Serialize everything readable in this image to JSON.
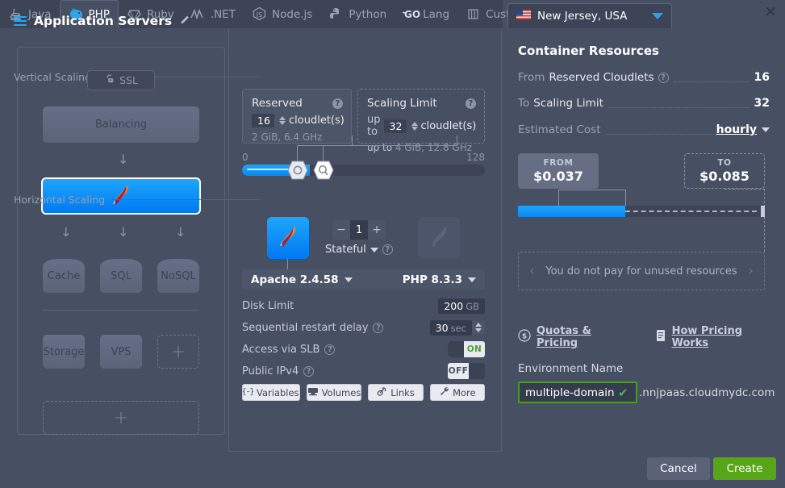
{
  "tabs": [
    {
      "label": "Java",
      "icon": "java-icon",
      "active": false
    },
    {
      "label": "PHP",
      "icon": "php-elephant-icon",
      "active": true
    },
    {
      "label": "Ruby",
      "icon": "ruby-gem-icon",
      "active": false
    },
    {
      "label": ".NET",
      "icon": "dotnet-icon",
      "active": false
    },
    {
      "label": "Node.js",
      "icon": "nodejs-icon",
      "active": false
    },
    {
      "label": "Python",
      "icon": "python-icon",
      "active": false
    },
    {
      "label": "Lang",
      "icon": "go-lang-icon",
      "active": false
    },
    {
      "label": "Custom",
      "icon": "custom-stack-icon",
      "active": false
    }
  ],
  "topology": {
    "ssl_label": "SSL",
    "balancing_label": "Balancing",
    "app_node_icon": "apache-feather-icon",
    "tier_nodes": [
      "Cache",
      "SQL",
      "NoSQL"
    ],
    "extra_nodes": [
      "Storage",
      "VPS"
    ],
    "add_label": "+"
  },
  "middle": {
    "title": "Application Servers",
    "toggle_label": "ON",
    "vertical_section": "Vertical Scaling per Node",
    "reserved": {
      "title": "Reserved",
      "value": "16",
      "unit": "cloudlet(s)",
      "detail": "2 GiB, 6.4 GHz"
    },
    "scaling_limit": {
      "title": "Scaling Limit",
      "prefix": "up to",
      "value": "32",
      "unit": "cloudlet(s)",
      "detail_prefix": "up to",
      "detail": "4 GiB, 12.8 GHz"
    },
    "slider": {
      "min": "0",
      "max": "128"
    },
    "horizontal_section": "Horizontal Scaling",
    "node_count": "1",
    "minus": "−",
    "plus": "+",
    "stateful_label": "Stateful",
    "stack_left": "Apache 2.4.58",
    "stack_right": "PHP 8.3.3",
    "props": [
      {
        "label": "Disk Limit",
        "value": "200",
        "unit": "GB",
        "has_help": false,
        "type": "chip"
      },
      {
        "label": "Sequential restart delay",
        "value": "30",
        "unit": "sec",
        "has_help": true,
        "type": "spinner"
      },
      {
        "label": "Access via SLB",
        "value": "ON",
        "has_help": true,
        "type": "toggle-on"
      },
      {
        "label": "Public IPv4",
        "value": "OFF",
        "has_help": true,
        "type": "toggle-off"
      }
    ],
    "buttons": [
      {
        "label": "Variables",
        "icon": "variables-icon"
      },
      {
        "label": "Volumes",
        "icon": "volumes-icon"
      },
      {
        "label": "Links",
        "icon": "links-icon"
      },
      {
        "label": "More",
        "icon": "wrench-icon"
      }
    ]
  },
  "right": {
    "region": "New Jersey, USA",
    "region_flag": "usa-flag-icon",
    "title": "Container Resources",
    "rows": [
      {
        "prefix": "From",
        "label": "Reserved Cloudlets",
        "help": true,
        "value": "16"
      },
      {
        "prefix": "To",
        "label": "Scaling Limit",
        "help": false,
        "value": "32"
      },
      {
        "prefix": "",
        "label": "Estimated Cost",
        "help": false,
        "value": "hourly"
      }
    ],
    "from_caption": "FROM",
    "from_price": "$0.037",
    "to_caption": "TO",
    "to_price": "$0.085",
    "unused_note": "You do not pay for unused resources",
    "quotas_link": "Quotas & Pricing",
    "pricing_link": "How Pricing Works",
    "env_label": "Environment Name",
    "env_value": "multiple-domain",
    "env_suffix": ".nnjpaas.cloudmydc.com"
  },
  "footer": {
    "cancel": "Cancel",
    "create": "Create"
  },
  "colors": {
    "accent": "#1ea6fb",
    "background": "#474f63",
    "panel": "#3d4456",
    "create_green": "#58a618",
    "on_green": "#49a13a"
  }
}
